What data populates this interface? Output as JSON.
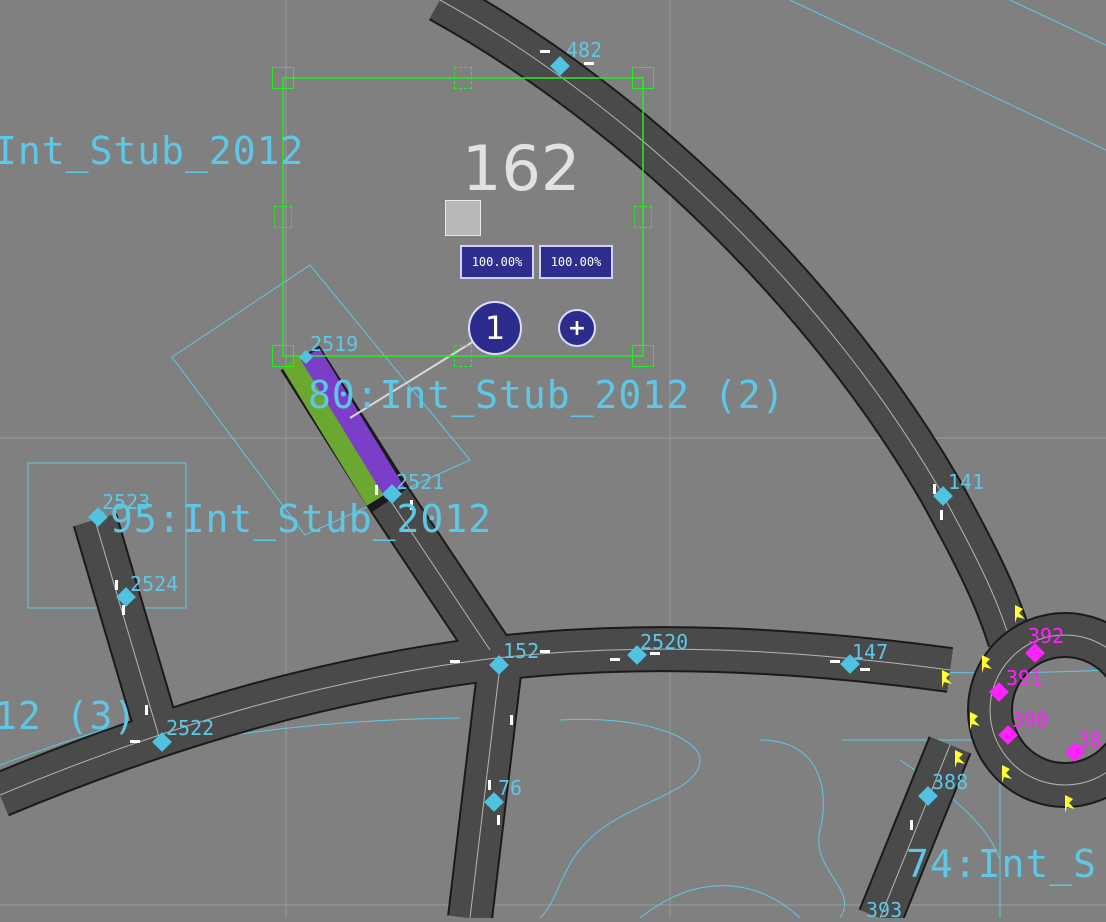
{
  "selected": {
    "value": "162",
    "percent_left": "100.00%",
    "percent_right": "100.00%",
    "phase_label": "1",
    "add_label": "+"
  },
  "zones": {
    "stub_top": "Int_Stub_2012",
    "stub_2": "80:Int_Stub_2012 (2)",
    "stub_95": "95:Int_Stub_2012",
    "stub_3": "12 (3)",
    "stub_74": "74:Int_S"
  },
  "nodes": [
    {
      "id": "482",
      "color": "cyan"
    },
    {
      "id": "2519",
      "color": "cyan"
    },
    {
      "id": "2521",
      "color": "cyan"
    },
    {
      "id": "2523",
      "color": "cyan"
    },
    {
      "id": "2524",
      "color": "cyan"
    },
    {
      "id": "2522",
      "color": "cyan"
    },
    {
      "id": "152",
      "color": "cyan"
    },
    {
      "id": "2520",
      "color": "cyan"
    },
    {
      "id": "147",
      "color": "cyan"
    },
    {
      "id": "141",
      "color": "cyan"
    },
    {
      "id": "76",
      "color": "cyan"
    },
    {
      "id": "388",
      "color": "cyan"
    },
    {
      "id": "392",
      "color": "magenta"
    },
    {
      "id": "391",
      "color": "magenta"
    },
    {
      "id": "390",
      "color": "magenta"
    },
    {
      "id": "38",
      "color": "magenta"
    },
    {
      "id": "393",
      "color": "cyan"
    }
  ],
  "colors": {
    "background": "#808080",
    "road": "#4a4a4a",
    "outline": "#5fc7e6",
    "selection": "#22ee22",
    "node_cyan": "#4fc3e0",
    "node_magenta": "#ff22ff",
    "link_green": "#6aa832",
    "link_purple": "#7a3ec8",
    "turn_yellow": "#ffff33"
  }
}
